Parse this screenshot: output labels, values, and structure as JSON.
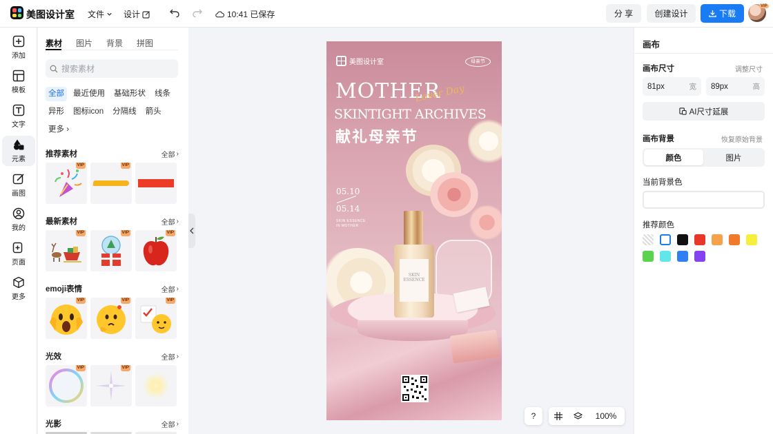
{
  "topbar": {
    "app_name": "美图设计室",
    "menu_file": "文件",
    "menu_design": "设计",
    "save_time": "10:41 已保存",
    "share_label": "分 享",
    "create_label": "创建设计",
    "download_label": "下载",
    "avatar_badge": "VIP"
  },
  "rail": {
    "items": [
      {
        "label": "添加",
        "icon": "plus-square-icon"
      },
      {
        "label": "模板",
        "icon": "template-icon"
      },
      {
        "label": "文字",
        "icon": "text-icon"
      },
      {
        "label": "元素",
        "icon": "shapes-icon"
      },
      {
        "label": "画图",
        "icon": "pencil-icon"
      },
      {
        "label": "我的",
        "icon": "user-icon"
      },
      {
        "label": "页面",
        "icon": "page-add-icon"
      },
      {
        "label": "更多",
        "icon": "cube-icon"
      }
    ]
  },
  "panel": {
    "tabs": [
      "素材",
      "图片",
      "背景",
      "拼图"
    ],
    "search_placeholder": "搜索素材",
    "chips": [
      "全部",
      "最近使用",
      "基础形状",
      "线条",
      "异形",
      "图标icon",
      "分隔线",
      "箭头",
      "更多"
    ],
    "sections": [
      {
        "title": "推荐素材",
        "more": "全部"
      },
      {
        "title": "最新素材",
        "more": "全部"
      },
      {
        "title": "emoji表情",
        "more": "全部"
      },
      {
        "title": "光效",
        "more": "全部"
      },
      {
        "title": "光影",
        "more": "全部"
      }
    ],
    "vip_label": "VIP"
  },
  "poster": {
    "brand": "美图设计室",
    "badge": "母亲节",
    "headline": "MOTHER",
    "script": "Lover Day",
    "subline": "SKINTIGHT ARCHIVES",
    "title_cn": "献礼母亲节",
    "date1": "05.10",
    "date2": "05.14",
    "small1": "SKIN ESSENCE",
    "small2": "IN MOTHER",
    "bottle_label": "SKIN ESSENCE"
  },
  "bottom": {
    "help": "?",
    "zoom": "100%"
  },
  "right": {
    "title": "画布",
    "size_label": "画布尺寸",
    "adjust_link": "调整尺寸",
    "width_value": "81px",
    "width_unit": "宽",
    "height_value": "89px",
    "height_unit": "高",
    "ai_button": "AI尺寸延展",
    "bg_label": "画布背景",
    "restore_link": "恢复原始背景",
    "seg_color": "颜色",
    "seg_image": "图片",
    "current_color_label": "当前背景色",
    "recommended_label": "推荐颜色",
    "swatches": [
      "transparent",
      "#ffffff",
      "#111111",
      "#e8382a",
      "#f4a34b",
      "#f07a2a",
      "#f6f03c",
      "#5ad44e",
      "#62e6ea",
      "#2f7ff2",
      "#8443ef"
    ]
  },
  "colors": {
    "accent": "#1a7cf5"
  }
}
